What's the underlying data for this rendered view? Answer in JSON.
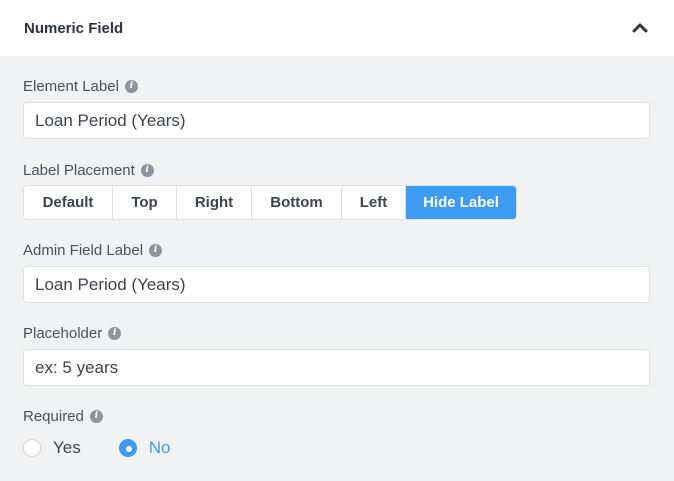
{
  "panel": {
    "title": "Numeric Field",
    "collapse_icon": "chevron-up-icon"
  },
  "element_label": {
    "label": "Element Label",
    "value": "Loan Period (Years)"
  },
  "label_placement": {
    "label": "Label Placement",
    "options": [
      "Default",
      "Top",
      "Right",
      "Bottom",
      "Left",
      "Hide Label"
    ],
    "selected": "Hide Label"
  },
  "admin_field_label": {
    "label": "Admin Field Label",
    "value": "Loan Period (Years)"
  },
  "placeholder": {
    "label": "Placeholder",
    "value": "ex: 5 years"
  },
  "required": {
    "label": "Required",
    "options": [
      "Yes",
      "No"
    ],
    "selected": "No"
  },
  "info_icon_glyph": "i",
  "colors": {
    "accent": "#3e9bf3",
    "background": "#f1f2f4",
    "header_bg": "#ffffff",
    "text": "#3d4350"
  }
}
